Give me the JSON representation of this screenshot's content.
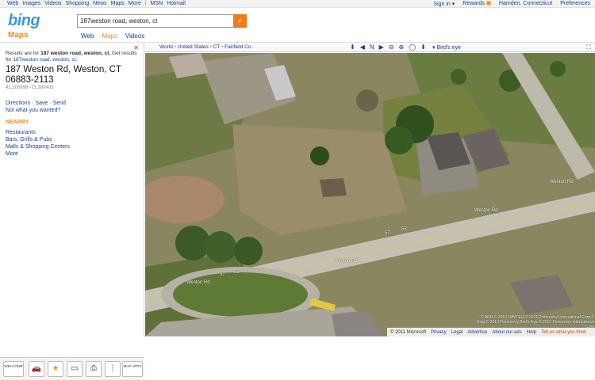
{
  "topnav": {
    "links": [
      "Web",
      "Images",
      "Videos",
      "Shopping",
      "News",
      "Maps",
      "More",
      "MSN",
      "Hotmail"
    ],
    "sign_in": "Sign in",
    "rewards": "Rewards",
    "location": "Hamden, Connecticut",
    "preferences": "Preferences"
  },
  "header": {
    "logo": "bing",
    "section_title": "Maps",
    "search_value": "187weston road, weston, ct",
    "tabs": [
      {
        "label": "Web",
        "active": false
      },
      {
        "label": "Maps",
        "active": true
      },
      {
        "label": "Videos",
        "active": false
      }
    ]
  },
  "sidebar": {
    "close_label": "✕",
    "results_prefix": "Results are for ",
    "results_query_bold": "187 weston road, weston, ct.",
    "results_mid": " Get results for ",
    "results_alt_link": "187weston road, weston, ct.",
    "address_line1": "187 Weston Rd, Weston, CT",
    "address_line2": "06883-2113",
    "coords": "41.200898 -73.380403",
    "actions": [
      "Directions",
      "Save",
      "Send"
    ],
    "not_what": "Not what you wanted?",
    "nearby_title": "NEARBY",
    "nearby_items": [
      "Restaurants",
      "Bars, Grills & Pubs",
      "Malls & Shopping Centers",
      "More"
    ]
  },
  "bottom_tools": [
    {
      "name": "welcome-tool",
      "label": "WELCOME"
    },
    {
      "name": "car-icon",
      "label": ""
    },
    {
      "name": "star-icon",
      "label": "★"
    },
    {
      "name": "money-icon",
      "label": ""
    },
    {
      "name": "printer-icon",
      "label": ""
    },
    {
      "name": "traffic-icon",
      "label": ""
    },
    {
      "name": "map-apps-tool",
      "label": "MAP APPS"
    }
  ],
  "mapbar": {
    "crumbs": [
      "World",
      "United States",
      "CT",
      "Fairfield Co."
    ],
    "birds_eye": "Bird's eye",
    "controls": [
      "⬇",
      "◀",
      "N",
      "▶",
      "⊖",
      "⊕",
      "◯",
      "⬇"
    ]
  },
  "map": {
    "road_labels": [
      "Weston Rd",
      "Weston Rd",
      "Weston Rd",
      "Weston Rd"
    ],
    "route_shields": [
      "57",
      "53",
      "57",
      "53"
    ],
    "image_credit": "© AND © 2010 NAVTEQ © 2011 Pictometry International Corp © Bing © 2010 Pictometry Bird's Eye © 2010 Pictometry International Corp",
    "copyright": "© 2011 Microsoft",
    "footer_links": [
      "Privacy",
      "Legal",
      "Advertise",
      "About our ads",
      "Help"
    ],
    "tell_us": "Tell us what you think"
  },
  "colors": {
    "accent_orange": "#f08a24",
    "link_blue": "#1a3e8c",
    "bing_blue": "#3a9ad9"
  }
}
